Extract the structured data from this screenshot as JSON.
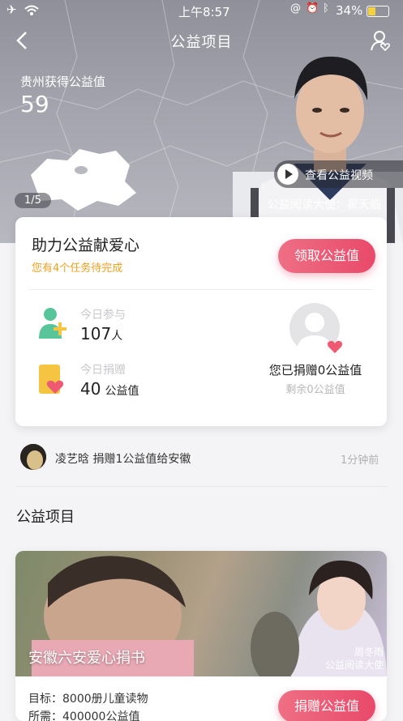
{
  "status_bar": {
    "time": "上午8:57",
    "battery": "34%"
  },
  "nav": {
    "title": "公益项目"
  },
  "hero": {
    "region_label": "贵州获得公益值",
    "region_value": "59",
    "page_indicator": "1/5",
    "video_button": "查看公益视频",
    "ambassador": "公益阅读大使：翟天临"
  },
  "task_card": {
    "title": "助力公益献爱心",
    "subtitle": "您有4个任务待完成",
    "claim_button": "领取公益值",
    "today_join_label": "今日参与",
    "today_join_value": "107",
    "today_join_unit": "人",
    "today_donate_label": "今日捐赠",
    "today_donate_value": "40",
    "today_donate_unit": "公益值",
    "donated_text": "您已捐赠0公益值",
    "remaining_text": "剩余0公益值"
  },
  "feed": {
    "text": "凌艺晗 捐赠1公益值给安徽",
    "time": "1分钟前"
  },
  "section": {
    "title": "公益项目"
  },
  "project": {
    "name": "安徽六安爱心捐书",
    "star_name": "周冬雨",
    "star_role": "公益阅读大使",
    "goal": "目标：8000册儿童读物",
    "need": "所需：400000公益值",
    "donate_button": "捐赠公益值"
  },
  "colors": {
    "accent": "#e9496a",
    "warning": "#f0a020",
    "join_icon": "#58c49a",
    "donate_icon": "#f5c542"
  }
}
